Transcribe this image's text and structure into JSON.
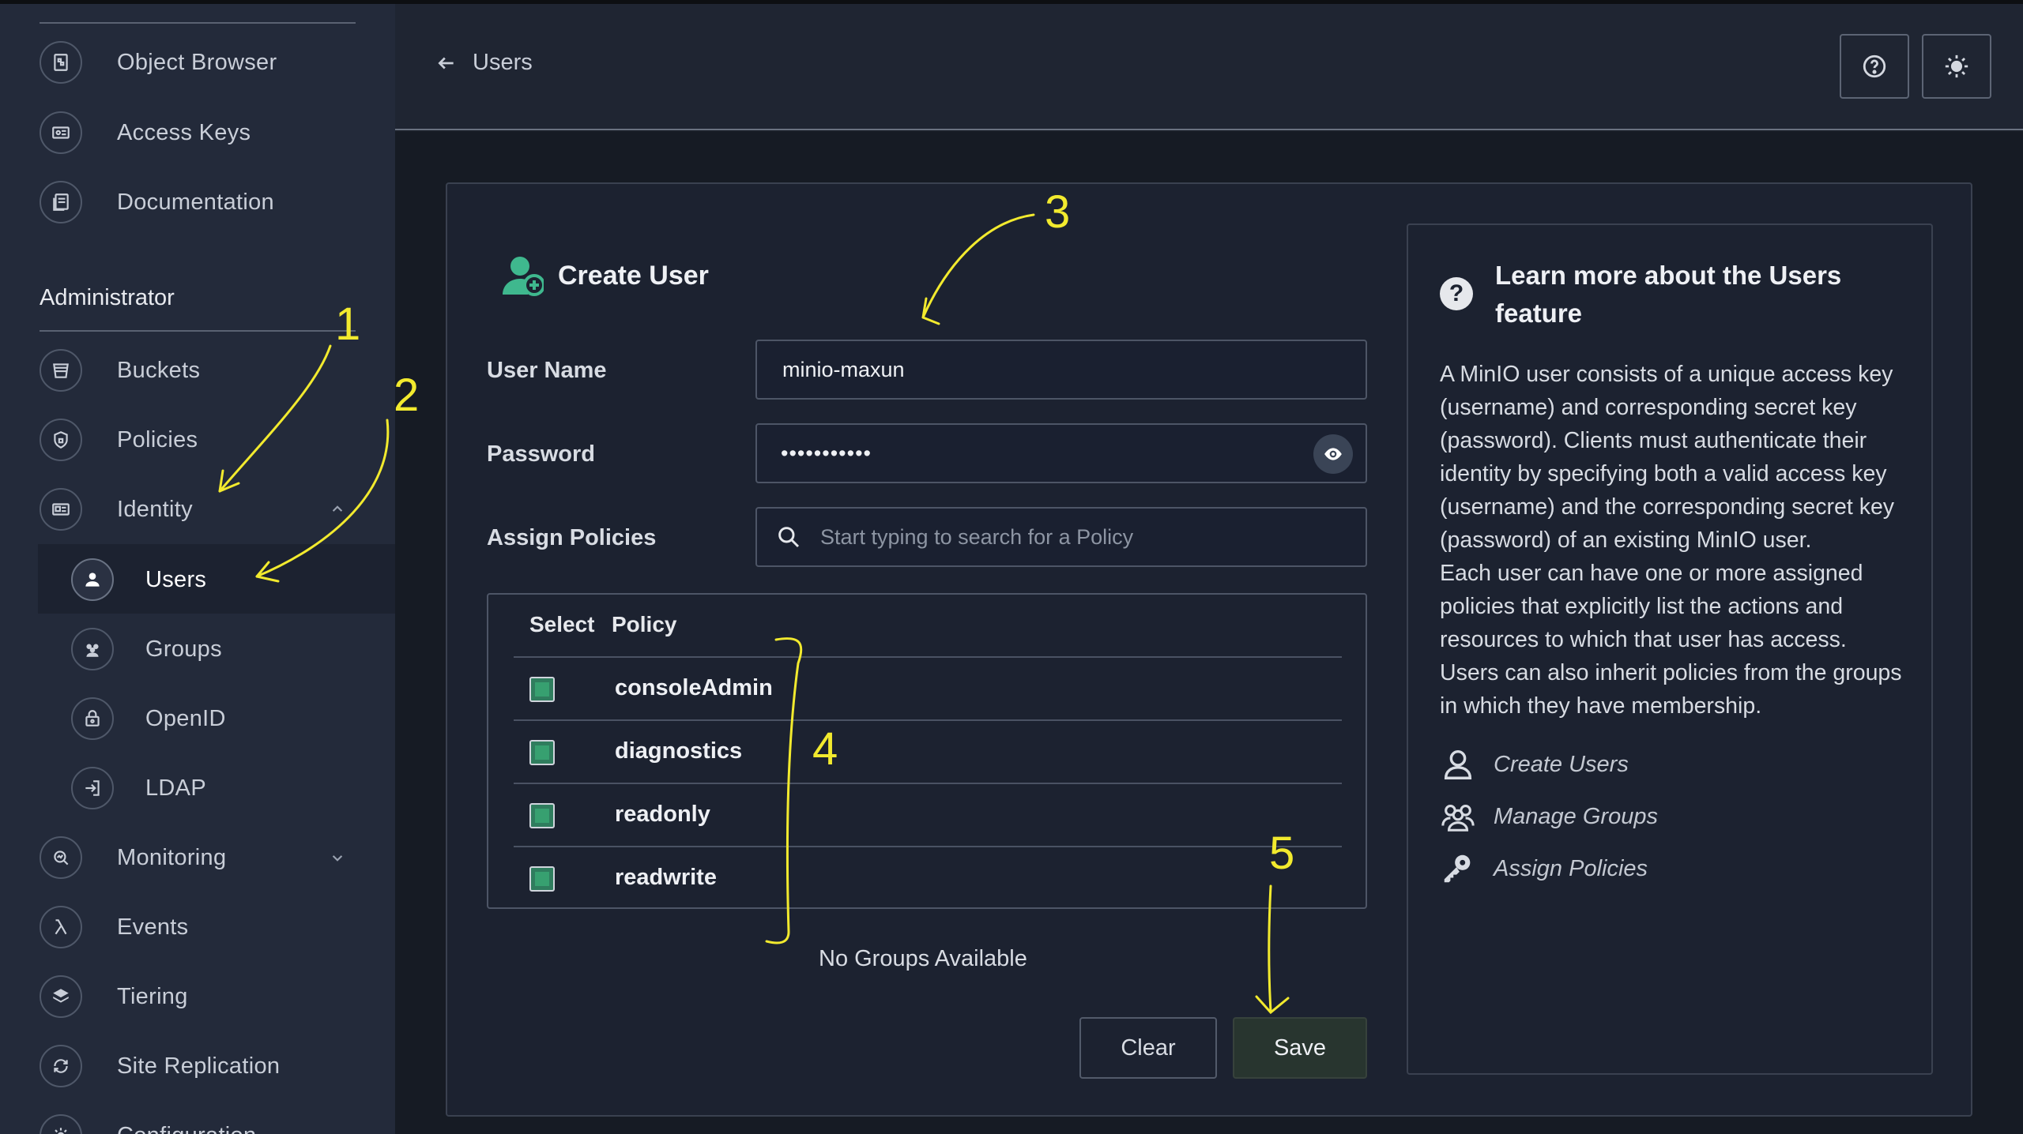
{
  "sidebar": {
    "top_items": [
      {
        "label": "Object Browser",
        "icon": "object-browser-icon"
      },
      {
        "label": "Access Keys",
        "icon": "access-keys-icon"
      },
      {
        "label": "Documentation",
        "icon": "documentation-icon"
      }
    ],
    "section_title": "Administrator",
    "admin_items": [
      {
        "label": "Buckets",
        "icon": "bucket-icon"
      },
      {
        "label": "Policies",
        "icon": "policy-shield-icon"
      },
      {
        "label": "Identity",
        "icon": "identity-card-icon",
        "expanded": true
      }
    ],
    "identity_sub": [
      {
        "label": "Users",
        "icon": "user-icon",
        "active": true
      },
      {
        "label": "Groups",
        "icon": "groups-icon"
      },
      {
        "label": "OpenID",
        "icon": "lock-icon"
      },
      {
        "label": "LDAP",
        "icon": "login-icon"
      }
    ],
    "bottom_items": [
      {
        "label": "Monitoring",
        "icon": "monitoring-icon"
      },
      {
        "label": "Events",
        "icon": "lambda-icon"
      },
      {
        "label": "Tiering",
        "icon": "layers-icon"
      },
      {
        "label": "Site Replication",
        "icon": "replication-icon"
      },
      {
        "label": "Configuration",
        "icon": "gear-icon"
      }
    ]
  },
  "header": {
    "back_label": "Users"
  },
  "form": {
    "title": "Create User",
    "username_label": "User Name",
    "username_value": "minio-maxun",
    "password_label": "Password",
    "password_value": "•••••••••••",
    "policies_label": "Assign Policies",
    "policies_placeholder": "Start typing to search for a Policy",
    "table_headers": {
      "select": "Select",
      "policy": "Policy"
    },
    "policies": [
      {
        "name": "consoleAdmin",
        "selected": true
      },
      {
        "name": "diagnostics",
        "selected": true
      },
      {
        "name": "readonly",
        "selected": true
      },
      {
        "name": "readwrite",
        "selected": true
      }
    ],
    "no_groups": "No Groups Available",
    "clear_label": "Clear",
    "save_label": "Save"
  },
  "help": {
    "title": "Learn more about the Users feature",
    "paragraph1": "A MinIO user consists of a unique access key (username) and corresponding secret key (password). Clients must authenticate their identity by specifying both a valid access key (username) and the corresponding secret key (password) of an existing MinIO user.",
    "paragraph2": "Each user can have one or more assigned policies that explicitly list the actions and resources to which that user has access. Users can also inherit policies from the groups in which they have membership.",
    "links": [
      {
        "label": "Create Users",
        "icon": "user-outline-icon"
      },
      {
        "label": "Manage Groups",
        "icon": "groups-outline-icon"
      },
      {
        "label": "Assign Policies",
        "icon": "key-icon"
      }
    ]
  },
  "annotations": [
    "1",
    "2",
    "3",
    "4",
    "5"
  ],
  "colors": {
    "sidebar_bg": "#232a3a",
    "main_bg": "#161b24",
    "accent_green": "#3fb88e",
    "annotation_yellow": "#f2ea2e"
  }
}
